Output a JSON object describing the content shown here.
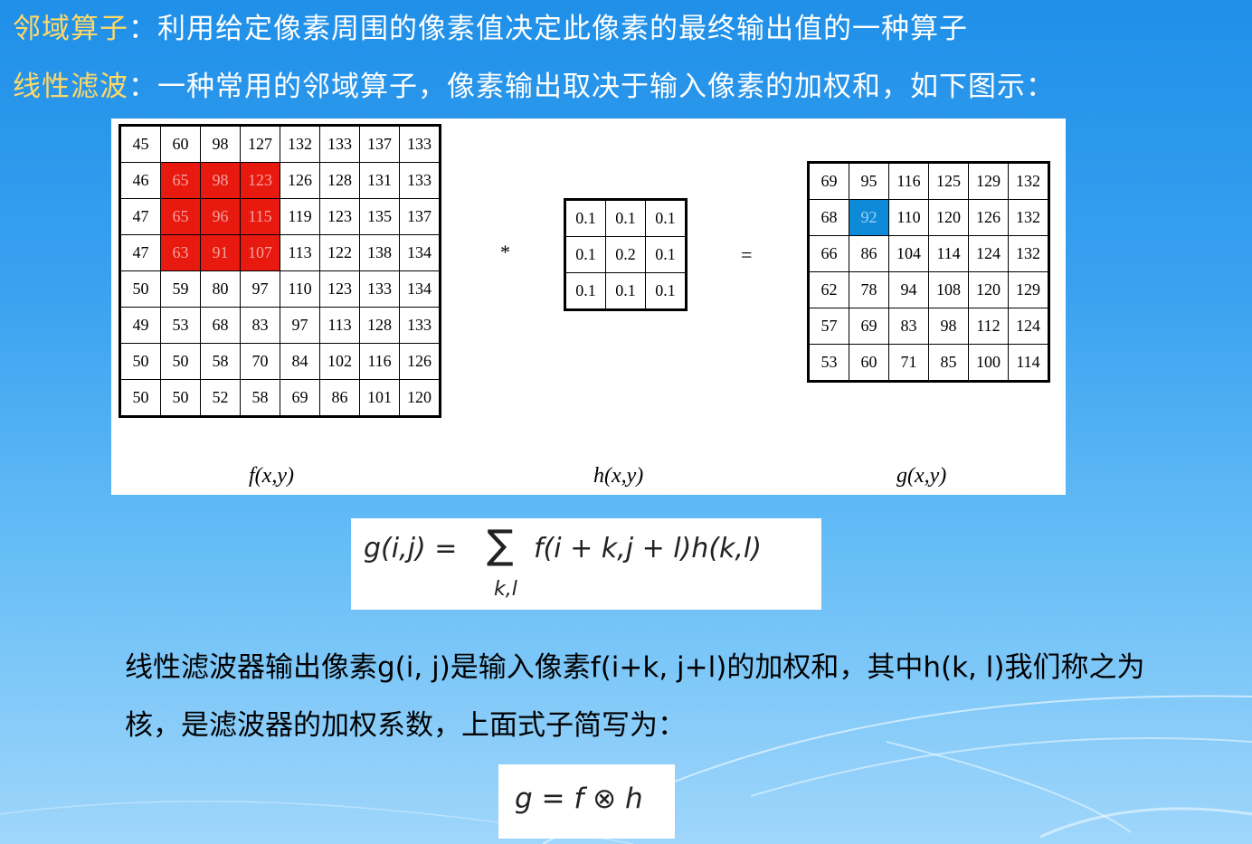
{
  "heading1": {
    "term": "邻域算子",
    "sep": "：",
    "text": "利用给定像素周围的像素值决定此像素的最终输出值的一种算子"
  },
  "heading2": {
    "term": "线性滤波",
    "sep": "：",
    "text": "一种常用的邻域算子，像素输出取决于输入像素的加权和，如下图示："
  },
  "figure": {
    "f_matrix": [
      [
        "45",
        "60",
        "98",
        "127",
        "132",
        "133",
        "137",
        "133"
      ],
      [
        "46",
        "65",
        "98",
        "123",
        "126",
        "128",
        "131",
        "133"
      ],
      [
        "47",
        "65",
        "96",
        "115",
        "119",
        "123",
        "135",
        "137"
      ],
      [
        "47",
        "63",
        "91",
        "107",
        "113",
        "122",
        "138",
        "134"
      ],
      [
        "50",
        "59",
        "80",
        "97",
        "110",
        "123",
        "133",
        "134"
      ],
      [
        "49",
        "53",
        "68",
        "83",
        "97",
        "113",
        "128",
        "133"
      ],
      [
        "50",
        "50",
        "58",
        "70",
        "84",
        "102",
        "116",
        "126"
      ],
      [
        "50",
        "50",
        "52",
        "58",
        "69",
        "86",
        "101",
        "120"
      ]
    ],
    "h_matrix": [
      [
        "0.1",
        "0.1",
        "0.1"
      ],
      [
        "0.1",
        "0.2",
        "0.1"
      ],
      [
        "0.1",
        "0.1",
        "0.1"
      ]
    ],
    "g_matrix": [
      [
        "69",
        "95",
        "116",
        "125",
        "129",
        "132"
      ],
      [
        "68",
        "92",
        "110",
        "120",
        "126",
        "132"
      ],
      [
        "66",
        "86",
        "104",
        "114",
        "124",
        "132"
      ],
      [
        "62",
        "78",
        "94",
        "108",
        "120",
        "129"
      ],
      [
        "57",
        "69",
        "83",
        "98",
        "112",
        "124"
      ],
      [
        "53",
        "60",
        "71",
        "85",
        "100",
        "114"
      ]
    ],
    "highlight_color_f": "#e8190f",
    "highlight_color_g": "#0d8ad8",
    "op_convolve": "*",
    "op_equals": "=",
    "label_f": "f(x,y)",
    "label_h": "h(x,y)",
    "label_g": "g(x,y)"
  },
  "formula1": {
    "lhs": "g(i,j) =",
    "sum": "∑",
    "rhs": "f(i + k,j + l)h(k,l)",
    "sub": "k,l"
  },
  "paragraph": {
    "line1": "线性滤波器输出像素g(i, j)是输入像素f(i+k, j+l)的加权和，其中h(k, l)我们称之为",
    "line2": "核，是滤波器的加权系数，上面式子简写为："
  },
  "formula2": {
    "text": "g = f ⊗ h"
  }
}
